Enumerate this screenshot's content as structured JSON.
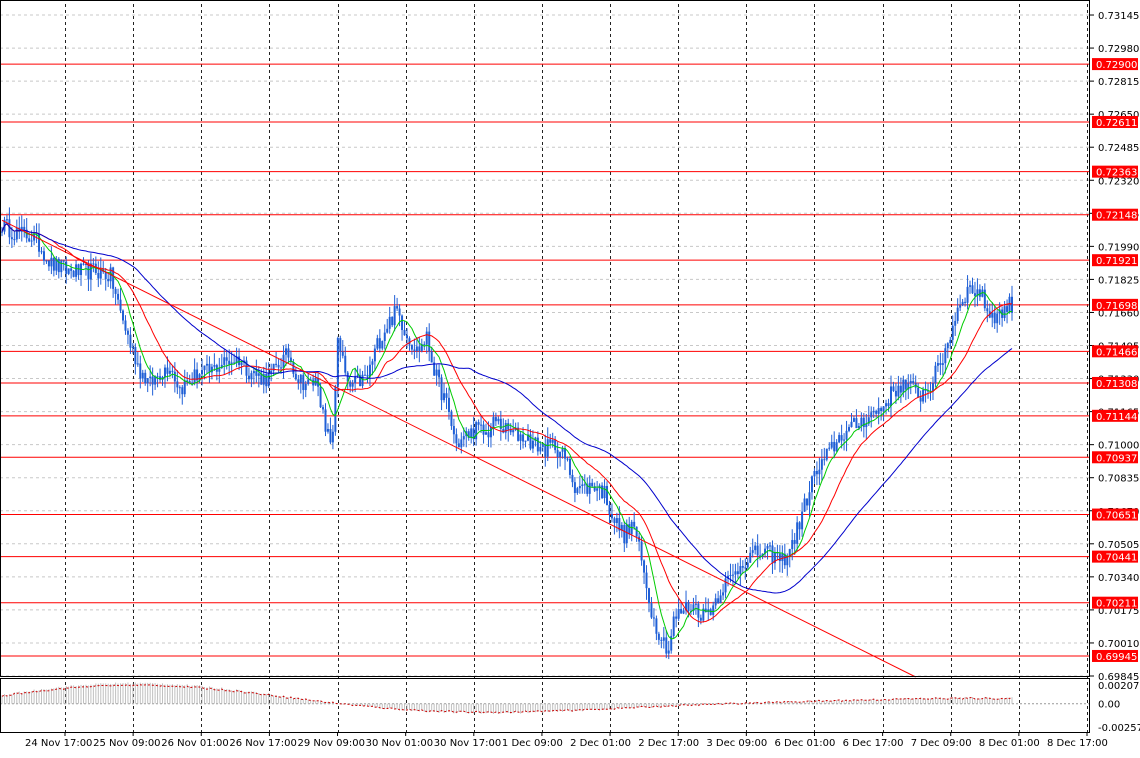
{
  "chart_data": {
    "type": "candlestick",
    "main_panel": {
      "price_range": [
        0.69845,
        0.732
      ],
      "price_tick_labels": [
        "0.73145",
        "0.72980",
        "0.72815",
        "0.72650",
        "0.72485",
        "0.72320",
        "0.72155",
        "0.71990",
        "0.71825",
        "0.71660",
        "0.71495",
        "0.71330",
        "0.71165",
        "0.71000",
        "0.70835",
        "0.70670",
        "0.70505",
        "0.70340",
        "0.70175",
        "0.70010",
        "0.69845"
      ],
      "price_ticks": [
        0.73145,
        0.7298,
        0.72815,
        0.7265,
        0.72485,
        0.7232,
        0.72155,
        0.7199,
        0.71825,
        0.7166,
        0.71495,
        0.7133,
        0.71165,
        0.71,
        0.70835,
        0.7067,
        0.70505,
        0.7034,
        0.70175,
        0.7001,
        0.69845
      ],
      "horizontal_levels": [
        {
          "label": "0.72900",
          "price": 0.729
        },
        {
          "label": "0.72611",
          "price": 0.72611
        },
        {
          "label": "0.72363",
          "price": 0.72363
        },
        {
          "label": "0.72148",
          "price": 0.72148
        },
        {
          "label": "0.71921",
          "price": 0.71921
        },
        {
          "label": "0.71698",
          "price": 0.71698
        },
        {
          "label": "0.71466",
          "price": 0.71466
        },
        {
          "label": "0.71308",
          "price": 0.71308
        },
        {
          "label": "0.71144",
          "price": 0.71144
        },
        {
          "label": "0.70937",
          "price": 0.70937
        },
        {
          "label": "0.70651",
          "price": 0.70651
        },
        {
          "label": "0.70441",
          "price": 0.70441
        },
        {
          "label": "0.70211",
          "price": 0.70211
        },
        {
          "label": "0.69945",
          "price": 0.69945
        }
      ],
      "close_anchors": [
        [
          0,
          0.721
        ],
        [
          4,
          0.7207
        ],
        [
          8,
          0.7205
        ],
        [
          12,
          0.7204
        ],
        [
          16,
          0.7198
        ],
        [
          20,
          0.719
        ],
        [
          26,
          0.7187
        ],
        [
          32,
          0.7186
        ],
        [
          38,
          0.7187
        ],
        [
          44,
          0.7184
        ],
        [
          48,
          0.7166
        ],
        [
          52,
          0.715
        ],
        [
          56,
          0.7137
        ],
        [
          60,
          0.713
        ],
        [
          64,
          0.7136
        ],
        [
          68,
          0.714
        ],
        [
          72,
          0.7128
        ],
        [
          76,
          0.7132
        ],
        [
          80,
          0.7136
        ],
        [
          84,
          0.7136
        ],
        [
          88,
          0.714
        ],
        [
          92,
          0.7142
        ],
        [
          96,
          0.7143
        ],
        [
          100,
          0.7137
        ],
        [
          104,
          0.7134
        ],
        [
          108,
          0.7133
        ],
        [
          112,
          0.714
        ],
        [
          116,
          0.7145
        ],
        [
          120,
          0.7133
        ],
        [
          124,
          0.713
        ],
        [
          128,
          0.7132
        ],
        [
          131,
          0.7105
        ],
        [
          134,
          0.7103
        ],
        [
          136,
          0.7155
        ],
        [
          140,
          0.7128
        ],
        [
          144,
          0.7131
        ],
        [
          148,
          0.7134
        ],
        [
          152,
          0.715
        ],
        [
          156,
          0.716
        ],
        [
          160,
          0.7167
        ],
        [
          164,
          0.7155
        ],
        [
          168,
          0.7147
        ],
        [
          172,
          0.7153
        ],
        [
          176,
          0.7133
        ],
        [
          180,
          0.712
        ],
        [
          184,
          0.71
        ],
        [
          188,
          0.7104
        ],
        [
          192,
          0.7108
        ],
        [
          196,
          0.7105
        ],
        [
          200,
          0.7112
        ],
        [
          204,
          0.7107
        ],
        [
          208,
          0.7105
        ],
        [
          212,
          0.7104
        ],
        [
          216,
          0.71
        ],
        [
          220,
          0.7098
        ],
        [
          224,
          0.71
        ],
        [
          228,
          0.7093
        ],
        [
          232,
          0.708
        ],
        [
          236,
          0.7078
        ],
        [
          240,
          0.708
        ],
        [
          244,
          0.7076
        ],
        [
          248,
          0.7062
        ],
        [
          252,
          0.7055
        ],
        [
          256,
          0.706
        ],
        [
          260,
          0.7035
        ],
        [
          264,
          0.7012
        ],
        [
          268,
          0.7002
        ],
        [
          270,
          0.6998
        ],
        [
          272,
          0.7012
        ],
        [
          276,
          0.7018
        ],
        [
          280,
          0.702
        ],
        [
          284,
          0.7015
        ],
        [
          288,
          0.702
        ],
        [
          292,
          0.703
        ],
        [
          296,
          0.7034
        ],
        [
          300,
          0.7042
        ],
        [
          304,
          0.7045
        ],
        [
          308,
          0.7046
        ],
        [
          312,
          0.7045
        ],
        [
          316,
          0.7042
        ],
        [
          320,
          0.705
        ],
        [
          324,
          0.7065
        ],
        [
          328,
          0.7082
        ],
        [
          332,
          0.709
        ],
        [
          336,
          0.7098
        ],
        [
          340,
          0.7105
        ],
        [
          344,
          0.7108
        ],
        [
          348,
          0.7112
        ],
        [
          352,
          0.7115
        ],
        [
          356,
          0.7118
        ],
        [
          360,
          0.7125
        ],
        [
          364,
          0.713
        ],
        [
          368,
          0.7128
        ],
        [
          372,
          0.7125
        ],
        [
          376,
          0.713
        ],
        [
          380,
          0.714
        ],
        [
          384,
          0.7155
        ],
        [
          388,
          0.7172
        ],
        [
          392,
          0.7178
        ],
        [
          396,
          0.7176
        ],
        [
          400,
          0.7165
        ],
        [
          404,
          0.7165
        ],
        [
          408,
          0.717
        ]
      ],
      "moving_averages": [
        {
          "color": "#00cc00",
          "period": 8
        },
        {
          "color": "#ff0000",
          "period": 21
        },
        {
          "color": "#0000cc",
          "period": 55
        }
      ],
      "trendline": {
        "color": "#ff0000",
        "from": [
          0,
          0.7212
        ],
        "to": [
          370,
          0.6984
        ]
      }
    },
    "sub_panel": {
      "tick_labels": [
        "0.002075",
        "0.00",
        "-0.002571"
      ],
      "ticks": [
        0.002075,
        0.0,
        -0.002571
      ],
      "range": [
        -0.0031,
        0.0026
      ],
      "histogram_color": "#c0c0c0",
      "signal_color": "#cc0000"
    },
    "x_tick_labels": [
      "24 Nov 17:00",
      "25 Nov 09:00",
      "26 Nov 01:00",
      "26 Nov 17:00",
      "29 Nov 09:00",
      "30 Nov 01:00",
      "30 Nov 17:00",
      "1 Dec 09:00",
      "2 Dec 01:00",
      "2 Dec 17:00",
      "3 Dec 09:00",
      "6 Dec 01:00",
      "6 Dec 17:00",
      "7 Dec 09:00",
      "8 Dec 01:00",
      "8 Dec 17:00"
    ],
    "bar_count": 410,
    "colors": {
      "bull": "#1f5fd6",
      "bear": "#1f5fd6",
      "level_line": "#ff0000",
      "level_label_bg": "#ff0000",
      "level_label_text": "#ffffff",
      "grid": "#c8c8c8",
      "vgrid": "#222222"
    }
  }
}
